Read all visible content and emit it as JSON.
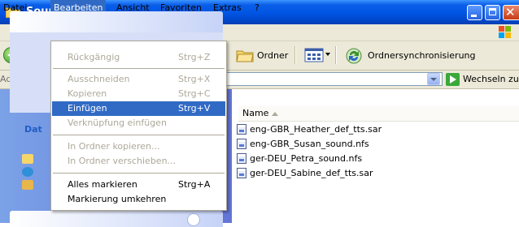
{
  "window": {
    "title": "Sounds"
  },
  "menubar": {
    "items": [
      "Datei",
      "Bearbeiten",
      "Ansicht",
      "Favoriten",
      "Extras",
      "?"
    ],
    "active": "Bearbeiten"
  },
  "toolbar": {
    "back_label": "Z",
    "folders_label": "Ordner",
    "sync_label": "Ordnersynchronisierung"
  },
  "addressbar": {
    "label": "Adresse",
    "value": "",
    "go_label": "Wechseln zu"
  },
  "taskpane": {
    "header_label": "Dat"
  },
  "file_list": {
    "column_name": "Name",
    "files": [
      "eng-GBR_Heather_def_tts.sar",
      "eng-GBR_Susan_sound.nfs",
      "ger-DEU_Petra_sound.nfs",
      "ger-DEU_Sabine_def_tts.sar"
    ]
  },
  "edit_menu": {
    "items": [
      {
        "label": "Rückgängig",
        "shortcut": "Strg+Z",
        "disabled": true
      },
      {
        "label": "Ausschneiden",
        "shortcut": "Strg+X",
        "disabled": true
      },
      {
        "label": "Kopieren",
        "shortcut": "Strg+C",
        "disabled": true
      },
      {
        "label": "Einfügen",
        "shortcut": "Strg+V",
        "disabled": false,
        "highlighted": true
      },
      {
        "label": "Verknüpfung einfügen",
        "shortcut": "",
        "disabled": true
      },
      {
        "label": "In Ordner kopieren...",
        "shortcut": "",
        "disabled": true
      },
      {
        "label": "In Ordner verschieben...",
        "shortcut": "",
        "disabled": true
      },
      {
        "label": "Alles markieren",
        "shortcut": "Strg+A",
        "disabled": false
      },
      {
        "label": "Markierung umkehren",
        "shortcut": "",
        "disabled": false
      }
    ]
  },
  "colors": {
    "titlebar": "#0054e3",
    "menu_highlight": "#316ac5",
    "disabled_text": "#aca899",
    "taskpane": "#7ba2e7"
  }
}
